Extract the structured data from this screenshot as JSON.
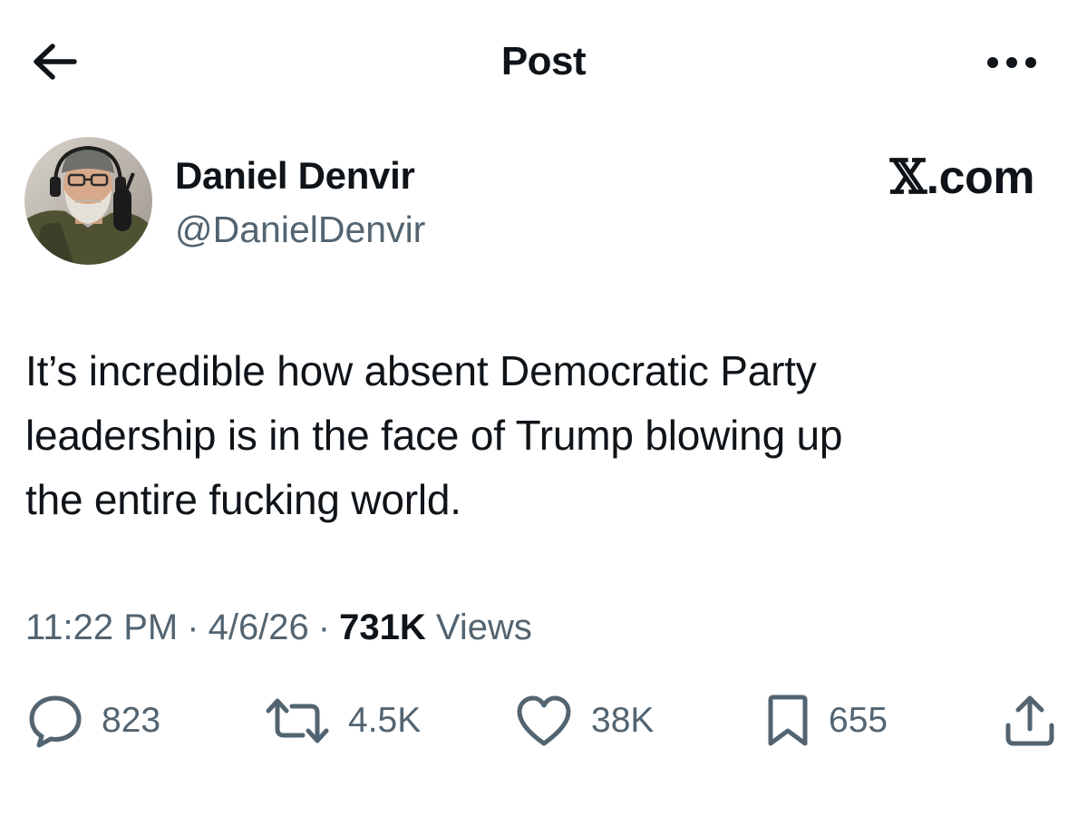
{
  "header": {
    "title": "Post",
    "back_icon": "arrow-left-icon",
    "more_icon": "more-horizontal-icon"
  },
  "author": {
    "display_name": "Daniel Denvir",
    "handle": "@DanielDenvir",
    "avatar_icon": "avatar-photo"
  },
  "watermark": {
    "x": "𝕏",
    "domain": ".com"
  },
  "post": {
    "text": "It’s incredible how absent Democratic Party\nleadership is in the face of Trump blowing up\nthe entire fucking world."
  },
  "meta": {
    "time": "11:22 PM",
    "date": "4/6/26",
    "separator": "·",
    "views_count": "731K",
    "views_label": "Views"
  },
  "actions": {
    "replies": "823",
    "reposts": "4.5K",
    "likes": "38K",
    "bookmarks": "655",
    "share_icon": "share-icon"
  },
  "colors": {
    "text_primary": "#0f1419",
    "text_secondary": "#536471",
    "background": "#ffffff"
  }
}
